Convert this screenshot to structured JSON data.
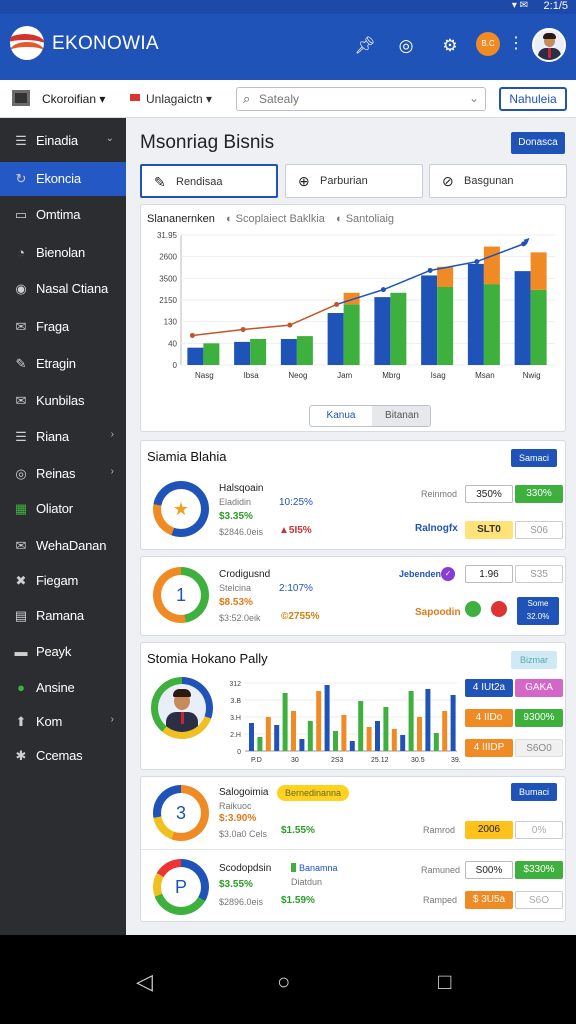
{
  "status": {
    "time": "2:1/5",
    "icons": "▾ ✉"
  },
  "app": {
    "title": "EKONOWIA",
    "badge": "B.C"
  },
  "toolbar": {
    "select1": "Ckoroifian ▾",
    "select2": "Unlagaictn ▾",
    "search_placeholder": "Satealy",
    "button": "Nahuleia"
  },
  "sidebar": {
    "items": [
      {
        "icon": "☰",
        "label": "Einadia",
        "caret": "⌄"
      },
      {
        "icon": "↻",
        "label": "Ekoncia",
        "caret": ""
      },
      {
        "icon": "▭",
        "label": "Omtima",
        "caret": ""
      },
      {
        "icon": "◔",
        "label": "Bienolan",
        "caret": ""
      },
      {
        "icon": "◉",
        "label": "Nasal Ctiana",
        "caret": ""
      },
      {
        "icon": "✉",
        "label": "Fraga",
        "caret": ""
      },
      {
        "icon": "✎",
        "label": "Etragin",
        "caret": ""
      },
      {
        "icon": "✉",
        "label": "Kunbilas",
        "caret": ""
      },
      {
        "icon": "☰",
        "label": "Riana",
        "caret": "›"
      },
      {
        "icon": "◎",
        "label": "Reinas",
        "caret": "›"
      },
      {
        "icon": "▦",
        "label": "Oliator",
        "caret": ""
      },
      {
        "icon": "✉",
        "label": "WehaDanan",
        "caret": ""
      },
      {
        "icon": "✖",
        "label": "Fiegam",
        "caret": ""
      },
      {
        "icon": "▤",
        "label": "Ramana",
        "caret": ""
      },
      {
        "icon": "▬",
        "label": "Peayk",
        "caret": ""
      },
      {
        "icon": "●",
        "label": "Ansine",
        "caret": ""
      },
      {
        "icon": "⬆",
        "label": "Kom",
        "caret": "›"
      },
      {
        "icon": "✱",
        "label": "Ccemas",
        "caret": ""
      }
    ]
  },
  "main": {
    "title": "Msonriag Bisnis",
    "button": "Donasca",
    "tabs": [
      {
        "icon": "✎",
        "label": "Rendisaa"
      },
      {
        "icon": "⊕",
        "label": "Parburian"
      },
      {
        "icon": "⊘",
        "label": "Basgunan"
      }
    ]
  },
  "chart_card": {
    "tab1": "Slananernken",
    "tab2": "Scoplaiect Baklkia",
    "tab3": "Santoliaig",
    "seg1": "Kanua",
    "seg2": "Bitanan"
  },
  "chart_data": {
    "type": "bar",
    "categories": [
      "Nasg",
      "Ibsa",
      "Neog",
      "Jam",
      "Mbrg",
      "Isag",
      "Msan",
      "Nwig"
    ],
    "yticks": [
      "0",
      "40",
      "130",
      "2150",
      "3500",
      "2600",
      "31.95"
    ],
    "series": [
      {
        "values": [
          120,
          160,
          180,
          360,
          470,
          620,
          700,
          650
        ],
        "color": "#1f53b8"
      },
      {
        "values": [
          150,
          180,
          200,
          420,
          500,
          540,
          560,
          520
        ],
        "color": "#3db03d"
      },
      {
        "values": [
          0,
          0,
          0,
          500,
          0,
          680,
          820,
          780
        ],
        "color": "#f08a24"
      }
    ],
    "line": [
      2.0,
      2.4,
      2.7,
      4.1,
      5.1,
      6.4,
      7.0,
      8.2
    ],
    "ylim": [
      0,
      900
    ]
  },
  "section1": {
    "title": "Siamia Blahia",
    "button": "Samaci",
    "rows": [
      {
        "name": "Halsqoain",
        "sub": "Eladidin",
        "pct": "10:25%",
        "price": "$3.35%",
        "gray": "$2846.0eis",
        "change": "▲5I5%",
        "label": "Reinmod",
        "val": "350%",
        "pill": "330%",
        "label2": "Ralnogfx",
        "val2": "SLT0",
        "pill2": "S06"
      },
      {
        "name": "Crodigusnd",
        "sub": "Stelcina",
        "pct": "2:107%",
        "price": "$8.53%",
        "gray": "$3:52.0eik",
        "change": "©2755%",
        "label": "Jebenden",
        "val": "1.96",
        "pill": "S35",
        "label2": "Sapoodin",
        "pill2": "Some 32.0%"
      }
    ]
  },
  "section2": {
    "title": "Stomia Hokano Pally",
    "button": "Bizmar",
    "xlabels": [
      "P.D",
      "30",
      "2S3",
      "25.12",
      "30.5",
      "39.18"
    ],
    "yvals": [
      "312",
      "3.B",
      "3.H",
      "2.H",
      "0"
    ],
    "pills": [
      {
        "text": "4 IUt2a",
        "bg": "#1f53b8",
        "fg": "#fff"
      },
      {
        "text": "GAKA",
        "bg": "#d466c8",
        "fg": "#fff"
      },
      {
        "text": "4 IIDo",
        "bg": "#f08a24",
        "fg": "#fff"
      },
      {
        "text": "9300%",
        "bg": "#3db03d",
        "fg": "#fff"
      },
      {
        "text": "4 IIIDP",
        "bg": "#f08a24",
        "fg": "#fff"
      },
      {
        "text": "S6O0",
        "bg": "#f0f0f0",
        "fg": "#888"
      }
    ]
  },
  "section3": {
    "button": "Bumaci",
    "rows": [
      {
        "ring": "3",
        "name": "Salogoimia",
        "tag": "Bernedinanna",
        "sub": "Raikuoc",
        "price": "$:3.90%",
        "gray": "$3.0a0 Cels",
        "change": "$1.55%",
        "label": "Ramrod",
        "val": "2006",
        "pill": "0%"
      },
      {
        "ring": "P",
        "name": "Scodopdsin",
        "tag": "Banamna",
        "sub": "Diatdun",
        "price": "$3.55%",
        "gray": "$2896.0eis",
        "change": "$1.59%",
        "label": "Ramuned",
        "val": "S00%",
        "pill": "$330%",
        "label2": "Ramped",
        "val2": "$ 3U5a",
        "pill2": "S6O"
      }
    ]
  },
  "nav": {
    "back": "◁",
    "home": "○",
    "recent": "□"
  }
}
